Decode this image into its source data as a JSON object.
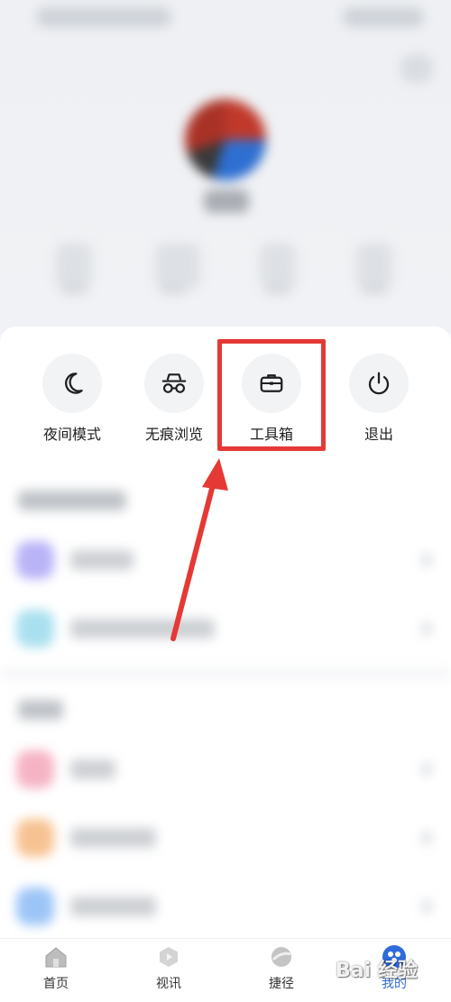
{
  "quick_actions": [
    {
      "label": "夜间模式",
      "icon": "moon-icon"
    },
    {
      "label": "无痕浏览",
      "icon": "incognito-icon"
    },
    {
      "label": "工具箱",
      "icon": "toolbox-icon"
    },
    {
      "label": "退出",
      "icon": "power-icon"
    }
  ],
  "highlight": {
    "target": "工具箱",
    "color": "#e53935"
  },
  "list_icon_colors": [
    "#b9b3f8",
    "#a9e0ef",
    "#f6b3c4",
    "#f7c291",
    "#9cc5f7"
  ],
  "tabs": [
    {
      "label": "首页",
      "icon": "home-icon",
      "active": false
    },
    {
      "label": "视讯",
      "icon": "video-icon",
      "active": false
    },
    {
      "label": "捷径",
      "icon": "shortcut-icon",
      "active": false
    },
    {
      "label": "我的",
      "icon": "profile-icon",
      "active": true
    }
  ],
  "colors": {
    "accent": "#2f6bdc",
    "annotation": "#e53935"
  },
  "watermark": "Bai 经验"
}
